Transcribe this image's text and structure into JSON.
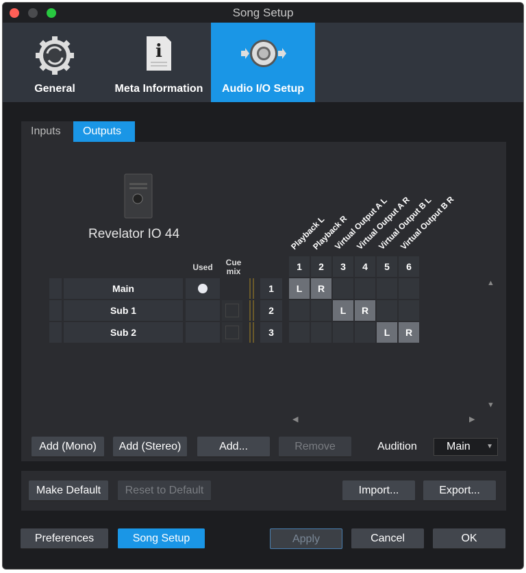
{
  "window": {
    "title": "Song Setup"
  },
  "header_tabs": [
    {
      "label": "General",
      "icon": "gear-sync-icon"
    },
    {
      "label": "Meta Information",
      "icon": "info-document-icon"
    },
    {
      "label": "Audio I/O Setup",
      "icon": "speaker-io-icon",
      "active": true
    }
  ],
  "sub_tabs": [
    {
      "label": "Inputs"
    },
    {
      "label": "Outputs",
      "active": true
    }
  ],
  "device": {
    "name": "Revelator IO 44"
  },
  "table": {
    "used_header": "Used",
    "cue_header": "Cue mix",
    "rows": [
      {
        "name": "Main",
        "used": true,
        "cue": false,
        "number": "1"
      },
      {
        "name": "Sub 1",
        "used": false,
        "cue": true,
        "number": "2"
      },
      {
        "name": "Sub 2",
        "used": false,
        "cue": true,
        "number": "3"
      }
    ]
  },
  "matrix": {
    "columns": [
      {
        "num": "1",
        "label": "Playback L"
      },
      {
        "num": "2",
        "label": "Playback R"
      },
      {
        "num": "3",
        "label": "Virtual Output A L"
      },
      {
        "num": "4",
        "label": "Virtual Output A R"
      },
      {
        "num": "5",
        "label": "Virtual Output B L"
      },
      {
        "num": "6",
        "label": "Virtual Output B R"
      }
    ],
    "assignments": [
      [
        "L",
        "R",
        "",
        "",
        "",
        ""
      ],
      [
        "",
        "",
        "L",
        "R",
        "",
        ""
      ],
      [
        "",
        "",
        "",
        "",
        "L",
        "R"
      ]
    ]
  },
  "buttons": {
    "add_mono": "Add (Mono)",
    "add_stereo": "Add (Stereo)",
    "add": "Add...",
    "remove": "Remove",
    "audition_label": "Audition",
    "audition_value": "Main",
    "make_default": "Make Default",
    "reset_default": "Reset to Default",
    "import": "Import...",
    "export": "Export...",
    "preferences": "Preferences",
    "song_setup": "Song Setup",
    "apply": "Apply",
    "cancel": "Cancel",
    "ok": "OK"
  },
  "colors": {
    "accent": "#1a96e6",
    "close": "#ff5f57",
    "zoom": "#28c840"
  }
}
